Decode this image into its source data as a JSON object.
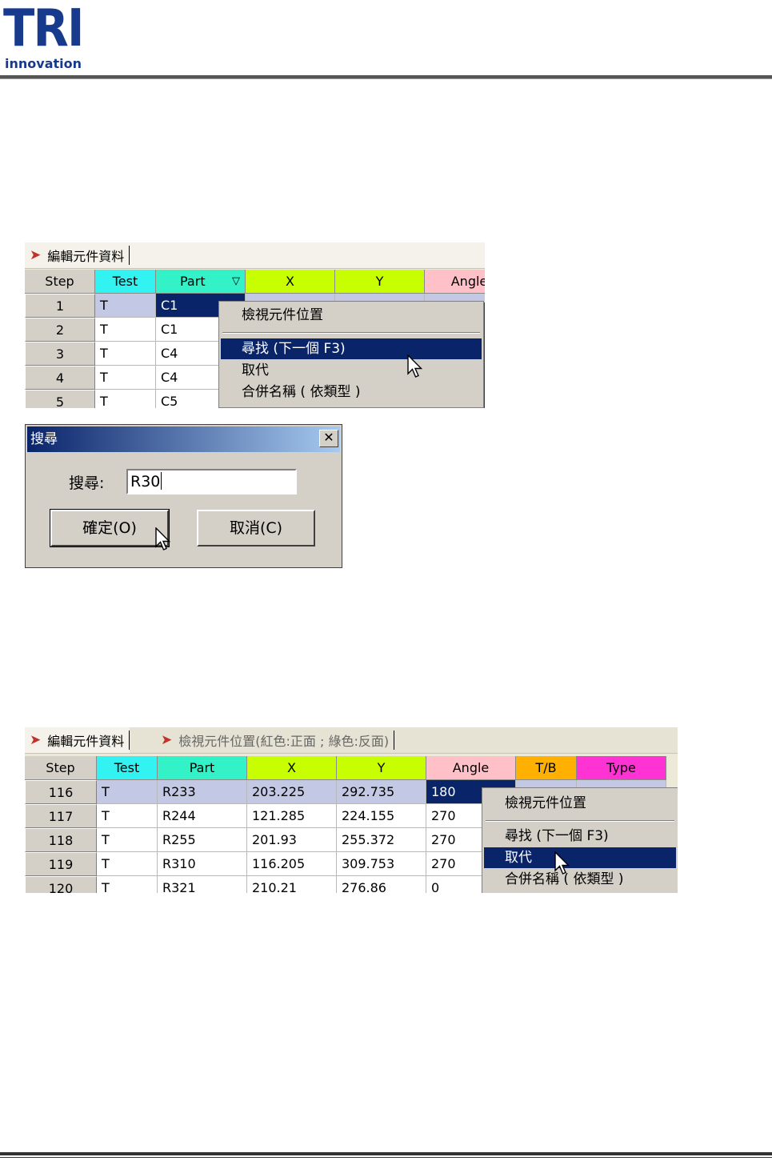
{
  "header": {
    "logo_main": "TRI",
    "logo_sub": "innovation"
  },
  "shot1": {
    "tab_label": "編輯元件資料",
    "columns": [
      "Step",
      "Test",
      "Part",
      "X",
      "Y",
      "Angle"
    ],
    "header_colors": {
      "Step": "#d4d0c8",
      "Test": "#33f2f2",
      "Part": "#33f2c8",
      "X": "#c8ff00",
      "Y": "#c8ff00",
      "Angle": "#ffc0c8"
    },
    "rows": [
      {
        "step": "1",
        "test": "T",
        "part": "C1"
      },
      {
        "step": "2",
        "test": "T",
        "part": "C1"
      },
      {
        "step": "3",
        "test": "T",
        "part": "C4"
      },
      {
        "step": "4",
        "test": "T",
        "part": "C4"
      },
      {
        "step": "5",
        "test": "T",
        "part": "C5"
      }
    ],
    "menu": [
      "檢視元件位置",
      "尋找 (下一個 F3)",
      "取代",
      "合併名稱 ( 依類型 )"
    ],
    "menu_active_index": 1
  },
  "dialog": {
    "title": "搜尋",
    "close_glyph": "✕",
    "label": "搜尋:",
    "value": "R30",
    "ok_label": "確定(O)",
    "cancel_label": "取消(C)"
  },
  "shot2": {
    "tab1_label": "編輯元件資料",
    "tab2_label": "檢視元件位置(紅色:正面 ; 綠色:反面)",
    "columns": [
      "Step",
      "Test",
      "Part",
      "X",
      "Y",
      "Angle",
      "T/B",
      "Type"
    ],
    "header_colors": {
      "Step": "#d4d0c8",
      "Test": "#33f2f2",
      "Part": "#33f2c8",
      "X": "#c8ff00",
      "Y": "#c8ff00",
      "Angle": "#ffc0c8",
      "T/B": "#ffb000",
      "Type": "#ff33d4"
    },
    "rows": [
      {
        "step": "116",
        "test": "T",
        "part": "R233",
        "x": "203.225",
        "y": "292.735",
        "angle": "180"
      },
      {
        "step": "117",
        "test": "T",
        "part": "R244",
        "x": "121.285",
        "y": "224.155",
        "angle": "270"
      },
      {
        "step": "118",
        "test": "T",
        "part": "R255",
        "x": "201.93",
        "y": "255.372",
        "angle": "270"
      },
      {
        "step": "119",
        "test": "T",
        "part": "R310",
        "x": "116.205",
        "y": "309.753",
        "angle": "270"
      },
      {
        "step": "120",
        "test": "T",
        "part": "R321",
        "x": "210.21",
        "y": "276.86",
        "angle": "0"
      }
    ],
    "menu": [
      "檢視元件位置",
      "尋找 (下一個 F3)",
      "取代",
      "合併名稱 ( 依類型 )"
    ],
    "menu_active_index": 2
  }
}
